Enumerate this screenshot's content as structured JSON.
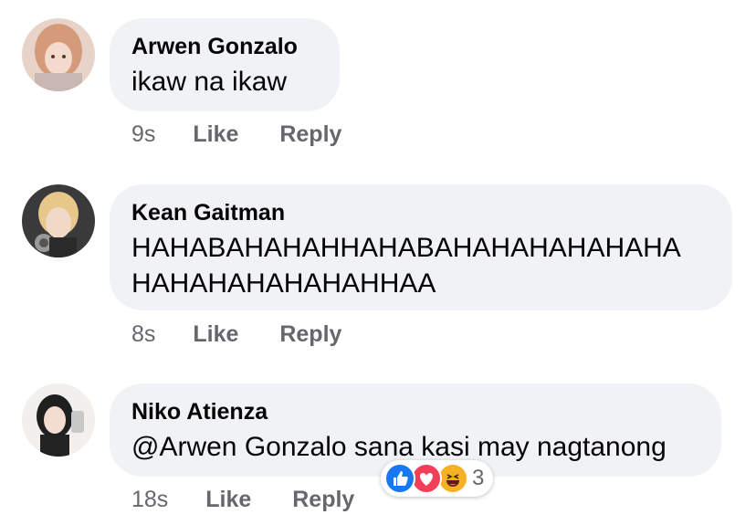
{
  "comments": [
    {
      "author": "Arwen Gonzalo",
      "text": "ikaw na ikaw",
      "time": "9s",
      "like_label": "Like",
      "reply_label": "Reply"
    },
    {
      "author": "Kean Gaitman",
      "text": "HAHABAHAHAHHAHABAHAHAHAHAHAHA\nHAHAHAHAHAHAHHAA",
      "time": "8s",
      "like_label": "Like",
      "reply_label": "Reply"
    },
    {
      "author": "Niko Atienza",
      "text": "@Arwen Gonzalo sana kasi may nagtanong",
      "time": "18s",
      "like_label": "Like",
      "reply_label": "Reply",
      "reactions": {
        "icons": [
          "like-icon",
          "love-icon",
          "haha-icon"
        ],
        "count": "3"
      }
    }
  ],
  "colors": {
    "bubble_bg": "#f0f2f5",
    "meta_text": "#65676b",
    "like_blue": "#1877f2",
    "love_red": "#f33e58",
    "haha_yellow": "#f7b125"
  }
}
